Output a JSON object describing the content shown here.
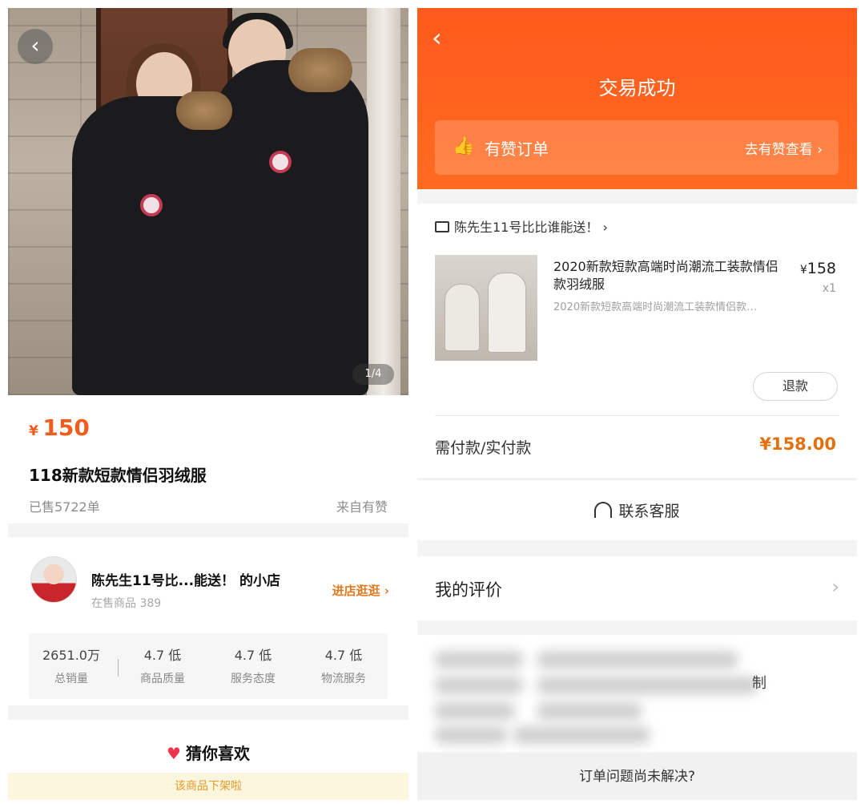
{
  "left": {
    "image_counter": "1/4",
    "product": {
      "currency": "¥",
      "price": "150",
      "title": "118新款短款情侣羽绒服",
      "sold": "已售5722单",
      "source": "来自有赞"
    },
    "shop": {
      "name": "陈先生11号比...能送！ 的小店",
      "goods_on_sale": "在售商品 389",
      "enter_label": "进店逛逛",
      "stats": [
        {
          "value": "2651.0万",
          "label": "总销量"
        },
        {
          "value": "4.7 低",
          "label": "商品质量"
        },
        {
          "value": "4.7 低",
          "label": "服务态度"
        },
        {
          "value": "4.7 低",
          "label": "物流服务"
        }
      ]
    },
    "guess": {
      "title": "猜你喜欢",
      "off_shelf_notice": "该商品下架啦"
    }
  },
  "right": {
    "status": "交易成功",
    "youzan_bar": {
      "label": "有赞订单",
      "link": "去有赞查看"
    },
    "order": {
      "store_name": "陈先生11号比比谁能送！",
      "product_title": "2020新款短款高端时尚潮流工装款情侣款羽绒服",
      "product_sub": "2020新款短款高端时尚潮流工装款情侣款…",
      "currency": "¥",
      "price": "158",
      "quantity": "x1",
      "refund_label": "退款",
      "pay_label": "需付款/实付款",
      "pay_amount": "¥158.00"
    },
    "contact_label": "联系客服",
    "review_label": "我的评价",
    "blurred_tail": "制",
    "issue_label": "订单问题尚未解决?"
  },
  "colors": {
    "accent_orange": "#ff5a1c",
    "price_orange": "#f25c1e",
    "link_orange": "#e07a20",
    "notice_bg": "#fdf6de"
  },
  "icons": [
    "back-arrow-icon",
    "thumbs-up-icon",
    "chevron-right-icon",
    "store-icon",
    "headset-icon",
    "heart-icon"
  ]
}
